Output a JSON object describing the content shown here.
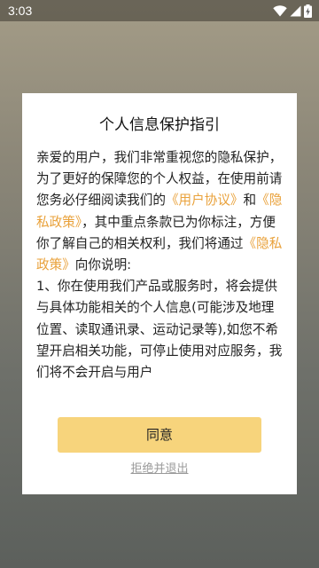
{
  "status_bar": {
    "time": "3:03",
    "icons": [
      "wifi-icon",
      "signal-icon",
      "battery-charging-icon"
    ]
  },
  "dialog": {
    "title": "个人信息保护指引",
    "body": {
      "p1": "亲爱的用户，我们非常重视您的隐私保护，为了更好的保障您的个人权益，在使用前请您务必仔细阅读我们的",
      "link_user_agreement": "《用户协议》",
      "and": "和",
      "link_privacy_policy": "《隐私政策》",
      "p2": "，其中重点条款已为你标注，方便你了解自己的相关权利，我们将通过",
      "link_privacy_policy_2": "《隐私政策》",
      "p3": "向你说明:",
      "p4": "1、你在使用我们产品或服务时，将会提供与具体功能相关的个人信息(可能涉及地理位置、读取通讯录、运动记录等),如您不希望开启相关功能，可停止使用对应服务，我们将不会开启与用户"
    },
    "agree_label": "同意",
    "reject_label": "拒绝并退出"
  },
  "colors": {
    "link": "#e9a13a",
    "agree_button": "#f7d47c"
  }
}
